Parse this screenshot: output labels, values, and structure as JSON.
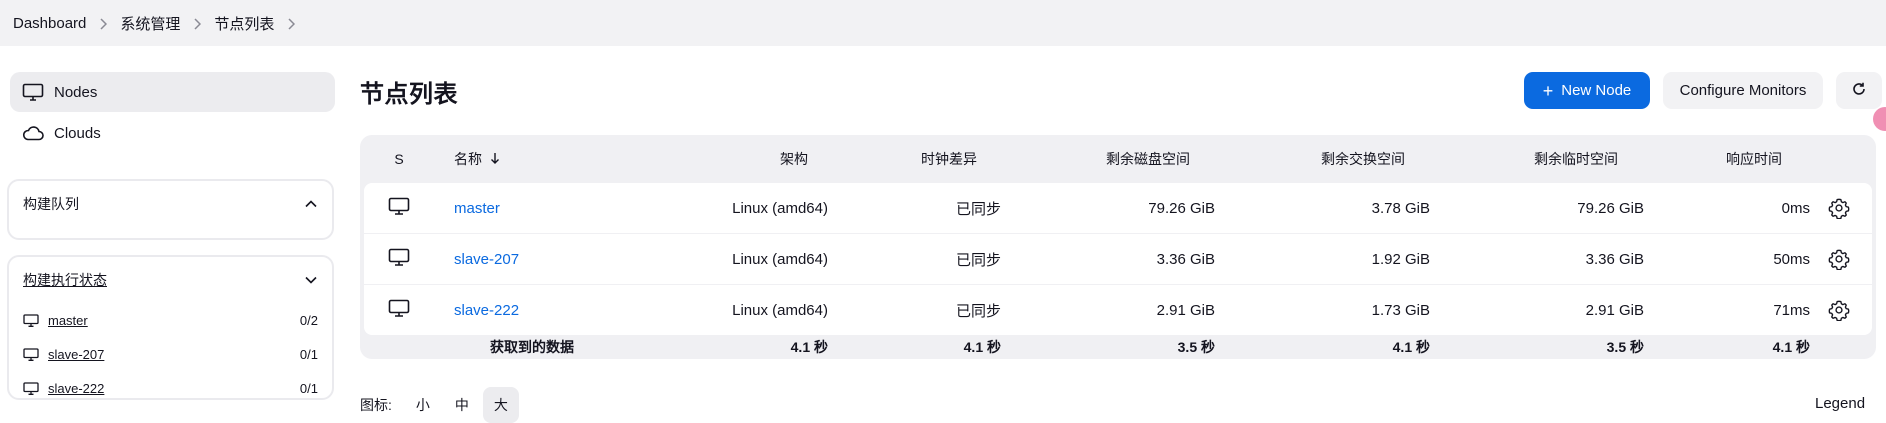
{
  "breadcrumb": [
    "Dashboard",
    "系统管理",
    "节点列表"
  ],
  "sidebar": {
    "items": [
      {
        "label": "Nodes",
        "icon": "monitor-icon",
        "active": true
      },
      {
        "label": "Clouds",
        "icon": "cloud-icon",
        "active": false
      }
    ]
  },
  "build_queue": {
    "title": "构建队列"
  },
  "executor_status": {
    "title": "构建执行状态",
    "nodes": [
      {
        "name": "master",
        "count": "0/2"
      },
      {
        "name": "slave-207",
        "count": "0/1"
      },
      {
        "name": "slave-222",
        "count": "0/1"
      }
    ]
  },
  "page": {
    "title": "节点列表"
  },
  "toolbar": {
    "new_node_label": "New Node",
    "configure_monitors_label": "Configure Monitors"
  },
  "table": {
    "headers": {
      "s": "S",
      "name": "名称",
      "arch": "架构",
      "clock": "时钟差异",
      "disk": "剩余磁盘空间",
      "swap": "剩余交换空间",
      "temp": "剩余临时空间",
      "resp": "响应时间"
    },
    "rows": [
      {
        "name": "master",
        "arch": "Linux (amd64)",
        "clock": "已同步",
        "disk": "79.26 GiB",
        "swap": "3.78 GiB",
        "temp": "79.26 GiB",
        "resp": "0ms"
      },
      {
        "name": "slave-207",
        "arch": "Linux (amd64)",
        "clock": "已同步",
        "disk": "3.36 GiB",
        "swap": "1.92 GiB",
        "temp": "3.36 GiB",
        "resp": "50ms"
      },
      {
        "name": "slave-222",
        "arch": "Linux (amd64)",
        "clock": "已同步",
        "disk": "2.91 GiB",
        "swap": "1.73 GiB",
        "temp": "2.91 GiB",
        "resp": "71ms"
      }
    ],
    "footer": {
      "label": "获取到的数据",
      "arch": "4.1 秒",
      "clock": "4.1 秒",
      "disk": "3.5 秒",
      "swap": "4.1 秒",
      "temp": "3.5 秒",
      "resp": "4.1 秒"
    }
  },
  "icon_size": {
    "label": "图标:",
    "options": [
      "小",
      "中",
      "大"
    ],
    "selected": "大"
  },
  "legend_label": "Legend",
  "colors": {
    "accent": "#0b6ae0",
    "link": "#0b6ae0"
  }
}
